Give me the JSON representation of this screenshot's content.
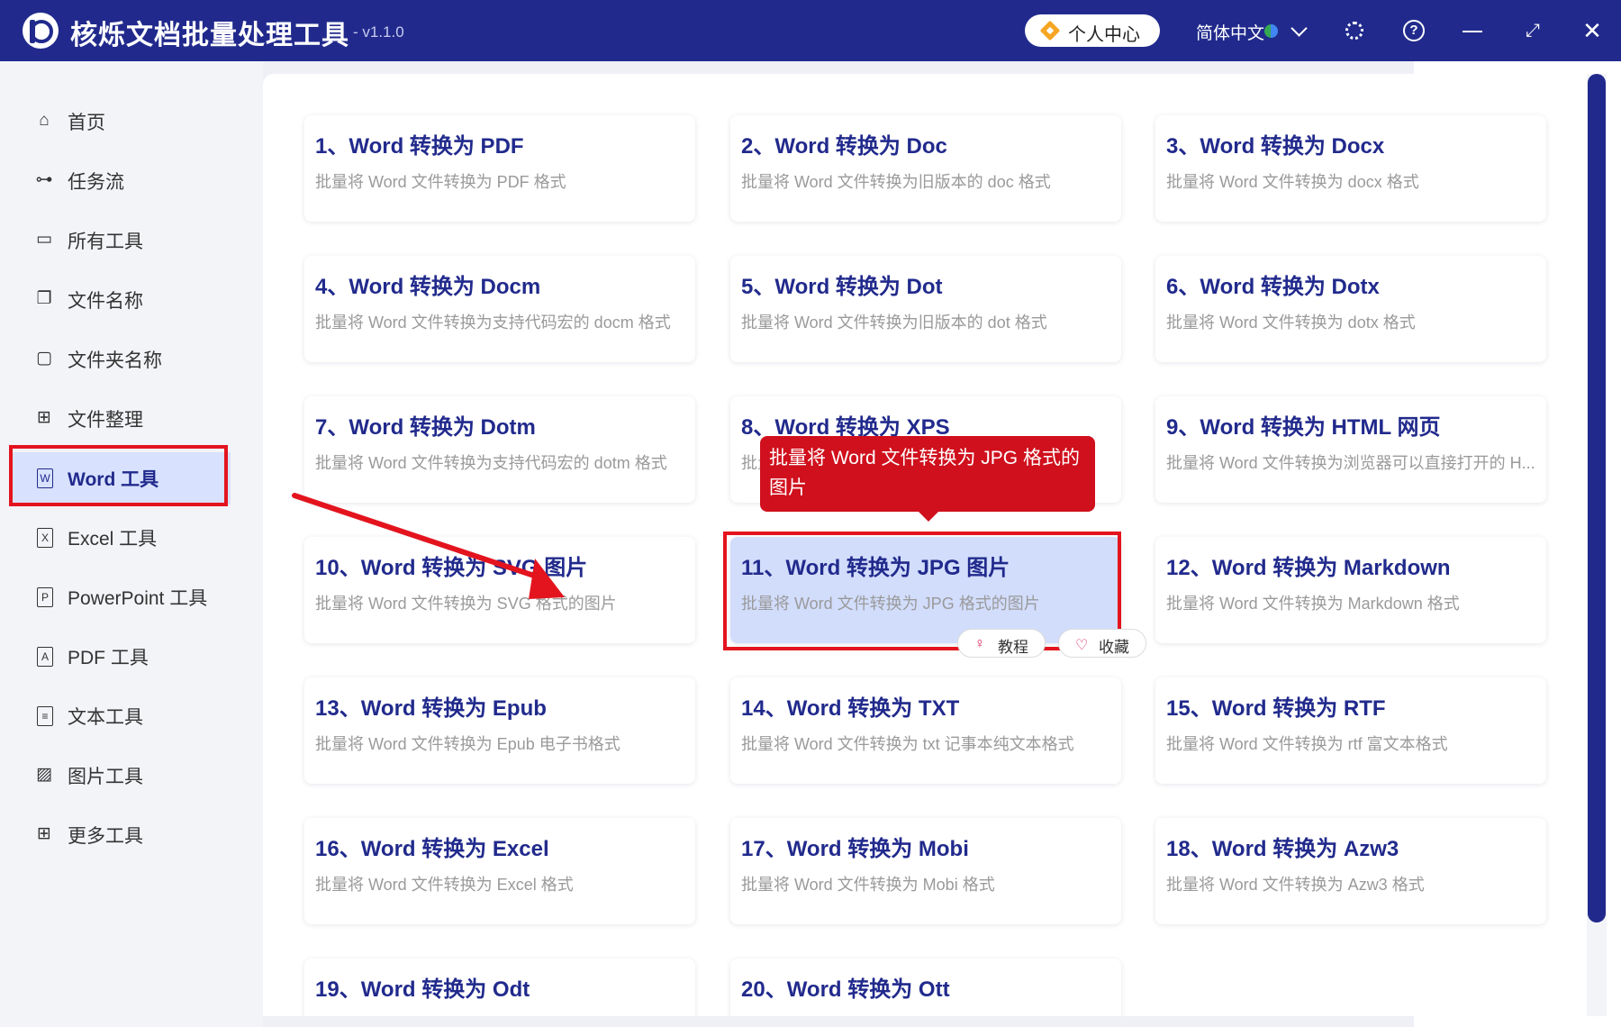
{
  "window": {
    "title": "核烁文档批量处理工具",
    "version": "- v1.1.0",
    "user_center": "个人中心",
    "language": "简体中文"
  },
  "sidebar": {
    "items": [
      {
        "label": "首页",
        "icon": "home-icon"
      },
      {
        "label": "任务流",
        "icon": "workflow-icon"
      },
      {
        "label": "所有工具",
        "icon": "monitor-icon"
      },
      {
        "label": "文件名称",
        "icon": "file-copy-icon"
      },
      {
        "label": "文件夹名称",
        "icon": "folder-icon"
      },
      {
        "label": "文件整理",
        "icon": "organize-icon"
      },
      {
        "label": "Word 工具",
        "icon": "word-file-icon",
        "active": true
      },
      {
        "label": "Excel 工具",
        "icon": "excel-file-icon"
      },
      {
        "label": "PowerPoint 工具",
        "icon": "ppt-file-icon"
      },
      {
        "label": "PDF 工具",
        "icon": "pdf-file-icon"
      },
      {
        "label": "文本工具",
        "icon": "text-file-icon"
      },
      {
        "label": "图片工具",
        "icon": "image-icon"
      },
      {
        "label": "更多工具",
        "icon": "grid-icon"
      }
    ]
  },
  "tools": [
    {
      "title": "1、Word 转换为 PDF",
      "desc": "批量将 Word 文件转换为 PDF 格式"
    },
    {
      "title": "2、Word 转换为 Doc",
      "desc": "批量将 Word 文件转换为旧版本的 doc 格式"
    },
    {
      "title": "3、Word 转换为 Docx",
      "desc": "批量将 Word 文件转换为 docx 格式"
    },
    {
      "title": "4、Word 转换为 Docm",
      "desc": "批量将 Word 文件转换为支持代码宏的 docm 格式"
    },
    {
      "title": "5、Word 转换为 Dot",
      "desc": "批量将 Word 文件转换为旧版本的 dot 格式"
    },
    {
      "title": "6、Word 转换为 Dotx",
      "desc": "批量将 Word 文件转换为 dotx 格式"
    },
    {
      "title": "7、Word 转换为 Dotm",
      "desc": "批量将 Word 文件转换为支持代码宏的 dotm 格式"
    },
    {
      "title": "8、Word 转换为 XPS",
      "desc": "批量将 Word 文件转换为 XPS 格式"
    },
    {
      "title": "9、Word 转换为 HTML 网页",
      "desc": "批量将 Word 文件转换为浏览器可以直接打开的 H..."
    },
    {
      "title": "10、Word 转换为 SVG 图片",
      "desc": "批量将 Word 文件转换为 SVG 格式的图片"
    },
    {
      "title": "11、Word 转换为 JPG 图片",
      "desc": "批量将 Word 文件转换为 JPG 格式的图片",
      "active": true
    },
    {
      "title": "12、Word 转换为 Markdown",
      "desc": "批量将 Word 文件转换为 Markdown 格式"
    },
    {
      "title": "13、Word 转换为 Epub",
      "desc": "批量将 Word 文件转换为 Epub 电子书格式"
    },
    {
      "title": "14、Word 转换为 TXT",
      "desc": "批量将 Word 文件转换为 txt 记事本纯文本格式"
    },
    {
      "title": "15、Word 转换为 RTF",
      "desc": "批量将 Word 文件转换为 rtf 富文本格式"
    },
    {
      "title": "16、Word 转换为 Excel",
      "desc": "批量将 Word 文件转换为 Excel 格式"
    },
    {
      "title": "17、Word 转换为 Mobi",
      "desc": "批量将 Word 文件转换为 Mobi 格式"
    },
    {
      "title": "18、Word 转换为 Azw3",
      "desc": "批量将 Word 文件转换为 Azw3 格式"
    },
    {
      "title": "19、Word 转换为 Odt",
      "desc": ""
    },
    {
      "title": "20、Word 转换为 Ott",
      "desc": ""
    }
  ],
  "tooltip": "批量将 Word 文件转换为 JPG 格式的图片",
  "card_actions": {
    "tutorial": "教程",
    "favorite": "收藏"
  },
  "colors": {
    "brand": "#212a8c",
    "highlight": "#e3141e",
    "active_bg": "#d2ddfc"
  }
}
